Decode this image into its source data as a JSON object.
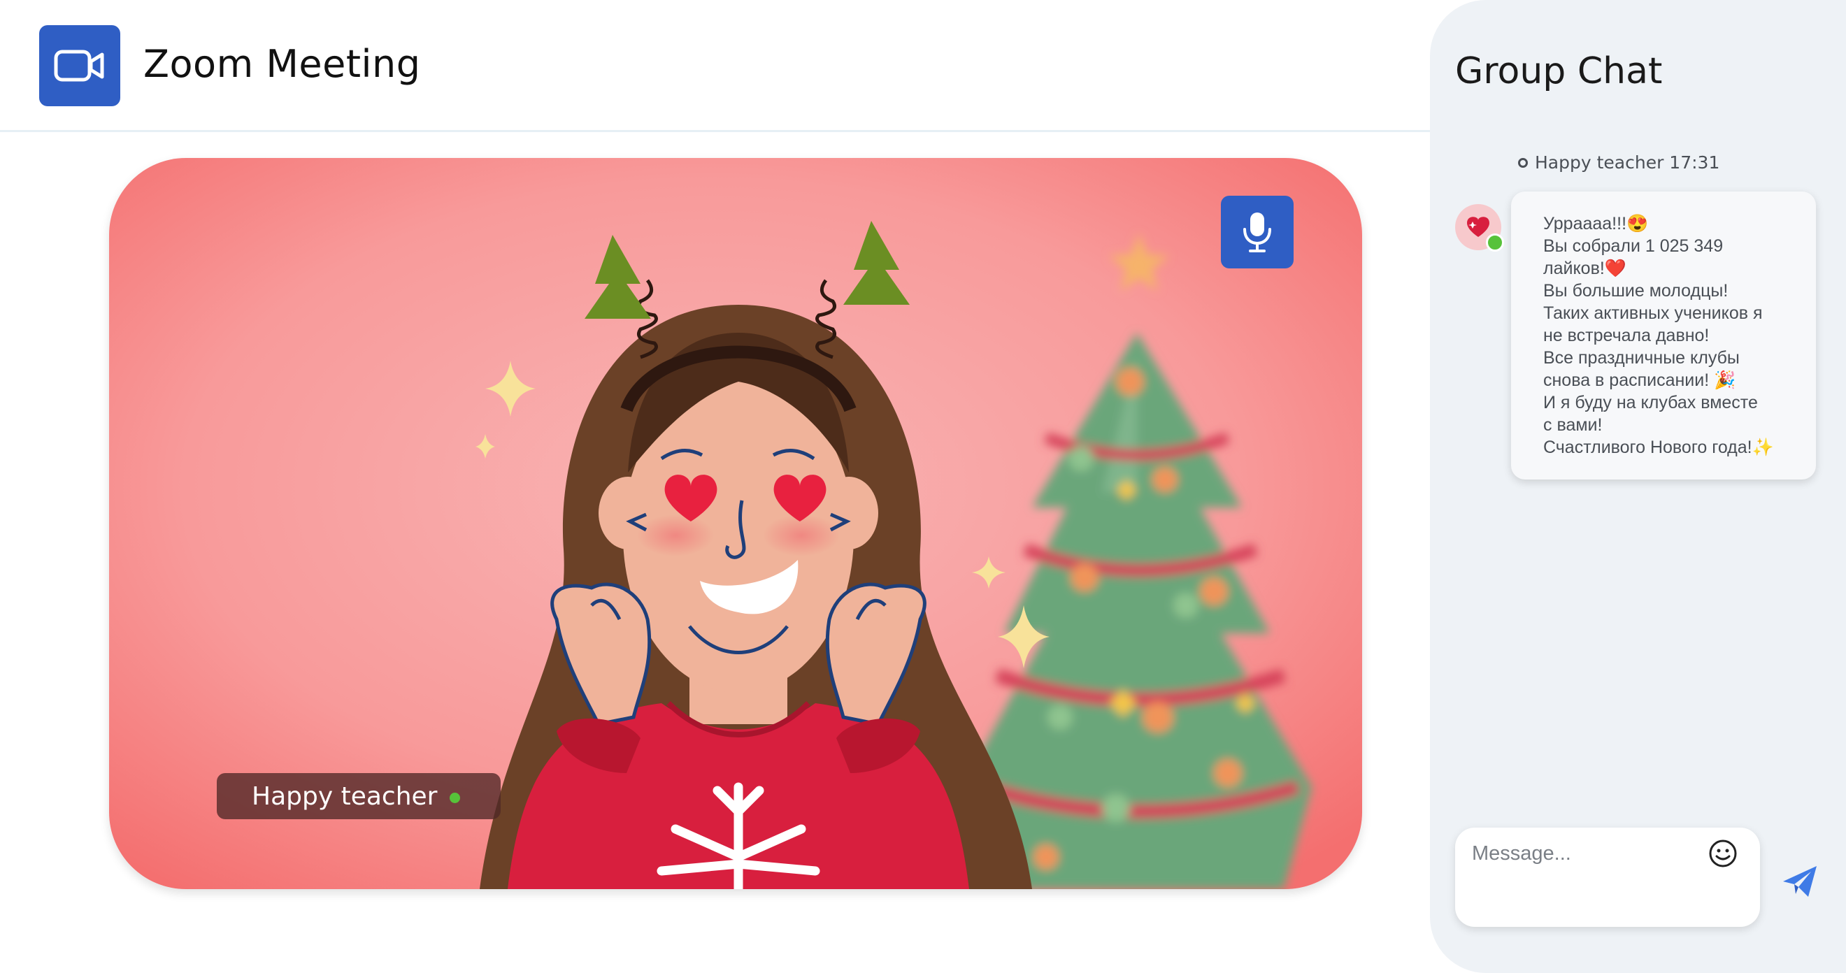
{
  "header": {
    "app_icon": "video-camera-icon",
    "title": "Zoom Meeting"
  },
  "video": {
    "participant_name": "Happy teacher",
    "mic_icon": "microphone-icon",
    "status_color": "#57c23a"
  },
  "chat": {
    "title": "Group Chat",
    "messages": [
      {
        "sender": "Happy teacher",
        "time": "17:31",
        "meta": "Happy teacher 17:31",
        "lines": [
          "Урраааа!!!😍",
          "Вы собрали 1 025 349",
          "лайков!❤️",
          "Вы большие молодцы!",
          "Таких активных учеников я",
          "не встречала давно!",
          "Все праздничные клубы",
          "снова в расписании! 🎉",
          "И я буду на клубах вместе",
          "с вами!",
          "Счастливого Нового года!✨"
        ]
      }
    ],
    "composer": {
      "placeholder": "Message...",
      "emoji_icon": "smiley-icon",
      "send_icon": "send-icon"
    }
  },
  "colors": {
    "accent": "#2f5ec4",
    "chat_bg": "#eef2f6",
    "send": "#3f7be6"
  }
}
